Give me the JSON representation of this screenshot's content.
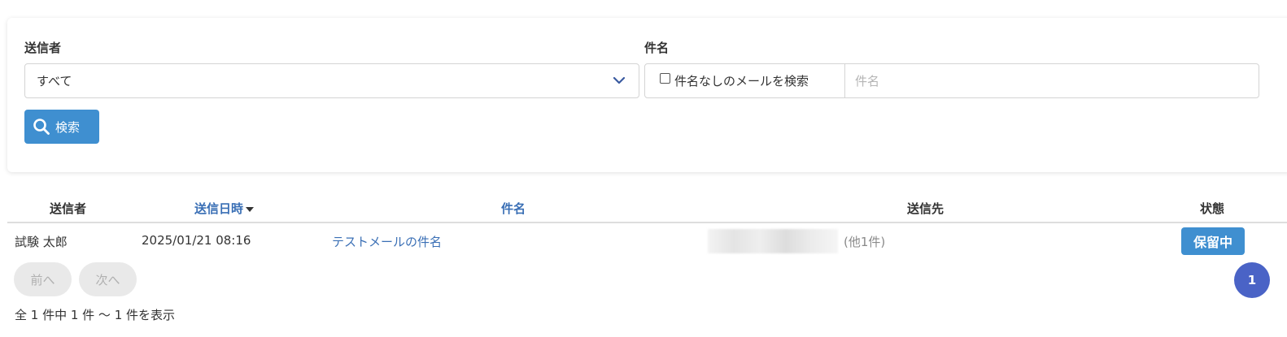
{
  "filters": {
    "sender_label": "送信者",
    "sender_value": "すべて",
    "subject_label": "件名",
    "no_subject_label": "件名なしのメールを検索",
    "subject_placeholder": "件名",
    "search_button": "検索"
  },
  "table": {
    "columns": {
      "sender": "送信者",
      "sent_at": "送信日時",
      "subject": "件名",
      "recipient": "送信先",
      "status": "状態"
    },
    "rows": [
      {
        "sender": "試験 太郎",
        "sent_at": "2025/01/21 08:16",
        "subject": "テストメールの件名",
        "recipient_extra": "(他1件)",
        "status": "保留中"
      }
    ]
  },
  "pagination": {
    "prev": "前へ",
    "next": "次へ",
    "current_page": "1",
    "summary": "全 1 件中 1 件 〜 1 件を表示"
  },
  "colors": {
    "primary": "#3f8fd0",
    "link": "#3a6fb5",
    "page_active": "#4a63c6"
  }
}
